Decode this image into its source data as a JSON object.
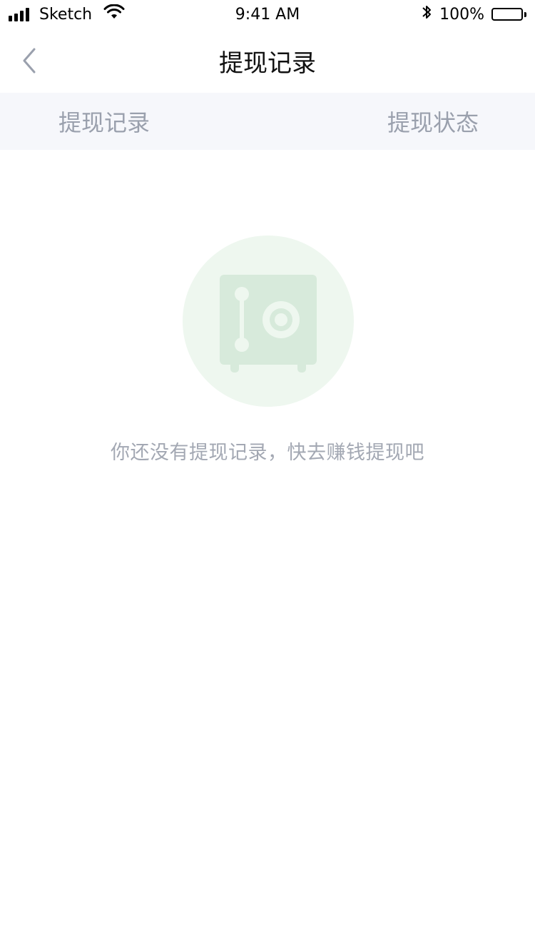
{
  "status_bar": {
    "carrier": "Sketch",
    "time": "9:41 AM",
    "battery": "100%",
    "battery_level": 1.0,
    "icons": [
      "signal-icon",
      "wifi-icon",
      "bluetooth-icon",
      "battery-icon"
    ]
  },
  "nav": {
    "title": "提现记录",
    "back_icon": "chevron-left-icon"
  },
  "tabs": [
    {
      "label": "提现记录"
    },
    {
      "label": "提现状态"
    }
  ],
  "empty": {
    "message": "你还没有提现记录，快去赚钱提现吧",
    "icon": "safe-icon"
  },
  "colors": {
    "tab_bar_bg": "#f6f7fb",
    "tab_text": "#9aa0ad",
    "empty_circle": "#eef7ef",
    "safe_icon": "#d7eadb",
    "empty_text": "#a3a8b3"
  }
}
